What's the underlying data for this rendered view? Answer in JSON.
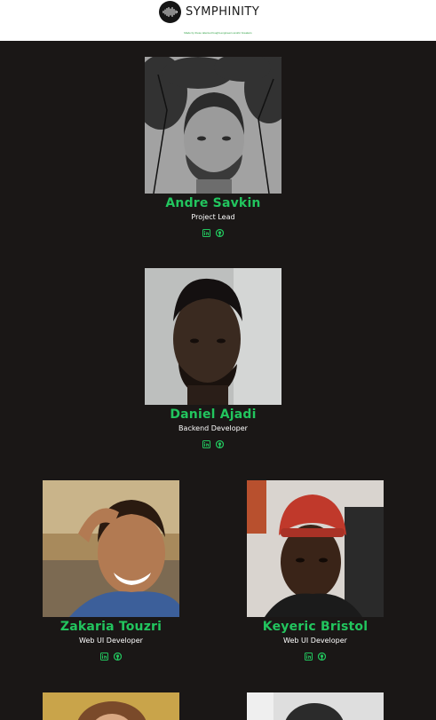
{
  "brand": {
    "name": "SYMPHINITY",
    "tagline": "Made by these talented fought-engineers and/or breakers",
    "accent": "#22c55e",
    "background": "#1a1716"
  },
  "team": [
    {
      "name": "Andre Savkin",
      "role": "Project Lead",
      "icons": [
        "linkedin-icon",
        "github-icon"
      ]
    },
    {
      "name": "Daniel Ajadi",
      "role": "Backend Developer",
      "icons": [
        "linkedin-icon",
        "github-icon"
      ]
    },
    {
      "name": "Zakaria Touzri",
      "role": "Web UI Developer",
      "icons": [
        "linkedin-icon",
        "github-icon"
      ]
    },
    {
      "name": "Keyeric Bristol",
      "role": "Web UI Developer",
      "icons": [
        "linkedin-icon",
        "github-icon"
      ]
    },
    {
      "name": "",
      "role": "",
      "icons": []
    },
    {
      "name": "",
      "role": "",
      "icons": []
    }
  ]
}
